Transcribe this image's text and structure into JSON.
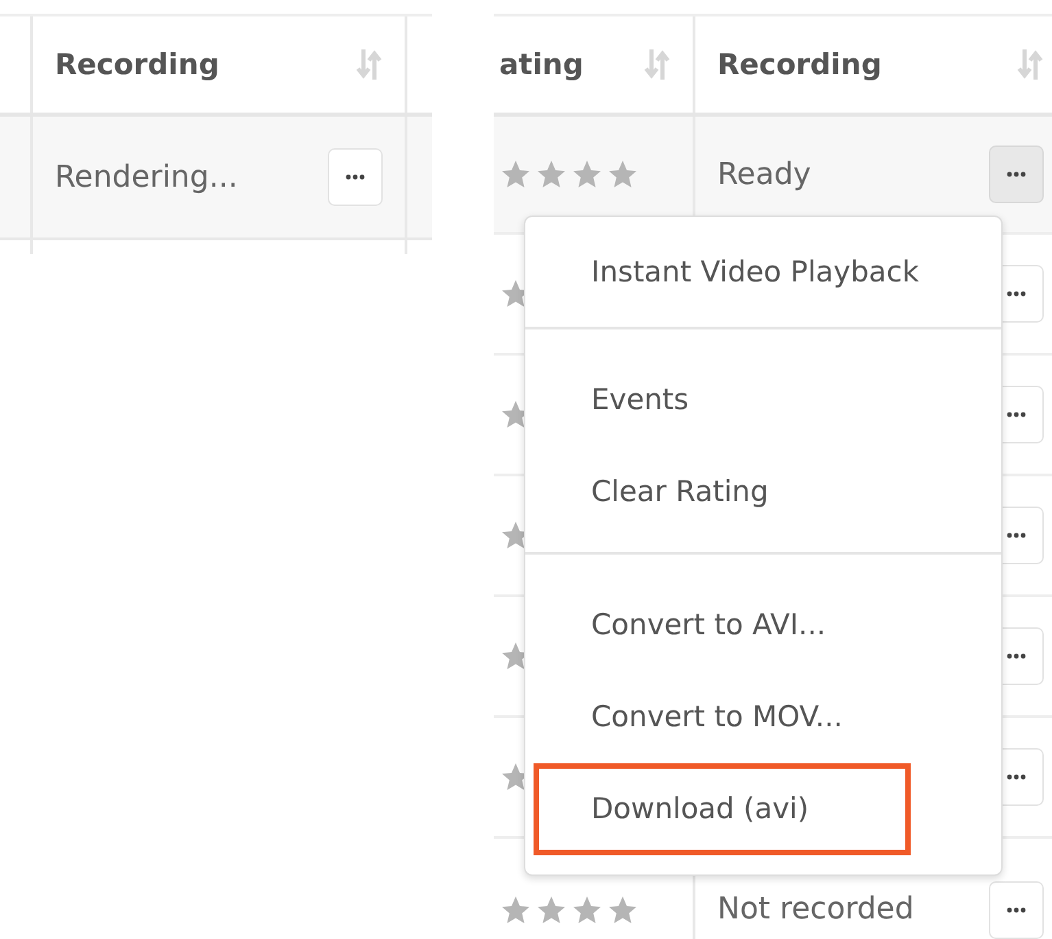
{
  "left_panel": {
    "columns": [
      {
        "label": "Recording"
      }
    ],
    "rows": [
      {
        "recording": "Rendering...",
        "menu_open": false
      }
    ]
  },
  "right_panel": {
    "columns": [
      {
        "label": "ating"
      },
      {
        "label": "Recording"
      }
    ],
    "rows": [
      {
        "kind": "full",
        "stars": 0,
        "recording": "Ready",
        "menu_open": true
      },
      {
        "kind": "covered"
      },
      {
        "kind": "covered"
      },
      {
        "kind": "covered"
      },
      {
        "kind": "covered"
      },
      {
        "kind": "covered"
      },
      {
        "kind": "full",
        "stars": 0,
        "recording": "Not recorded",
        "menu_open": false
      }
    ]
  },
  "context_menu": {
    "groups": [
      [
        {
          "label": "Instant Video Playback",
          "highlighted": false
        }
      ],
      [
        {
          "label": "Events",
          "highlighted": false
        },
        {
          "label": "Clear Rating",
          "highlighted": false
        }
      ],
      [
        {
          "label": "Convert to AVI...",
          "highlighted": false
        },
        {
          "label": "Convert to MOV...",
          "highlighted": false
        },
        {
          "label": "Download (avi)",
          "highlighted": true
        }
      ]
    ]
  }
}
